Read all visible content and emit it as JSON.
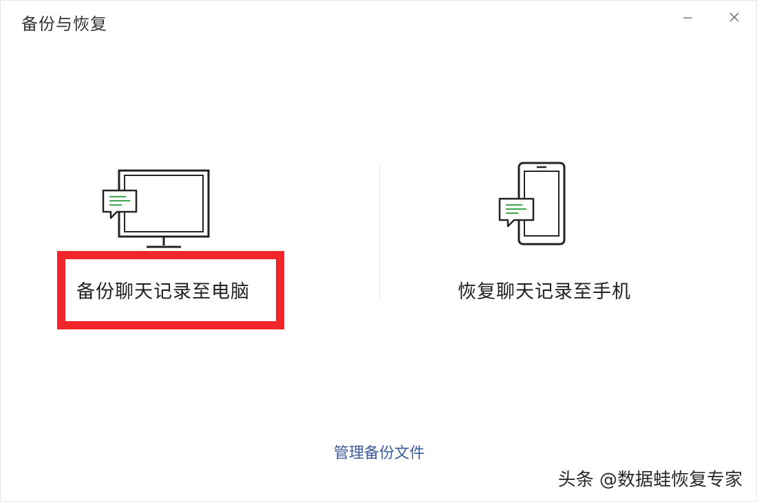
{
  "window": {
    "title": "备份与恢复"
  },
  "options": {
    "backup": {
      "label": "备份聊天记录至电脑",
      "icon": "monitor-chat-icon"
    },
    "restore": {
      "label": "恢复聊天记录至手机",
      "icon": "phone-chat-icon"
    }
  },
  "footer": {
    "manage_label": "管理备份文件"
  },
  "watermark": {
    "text": "头条 @数据蛙恢复专家"
  },
  "colors": {
    "highlight": "#f0262b",
    "link": "#3b5b9a",
    "chat_accent": "#3aa84a"
  }
}
